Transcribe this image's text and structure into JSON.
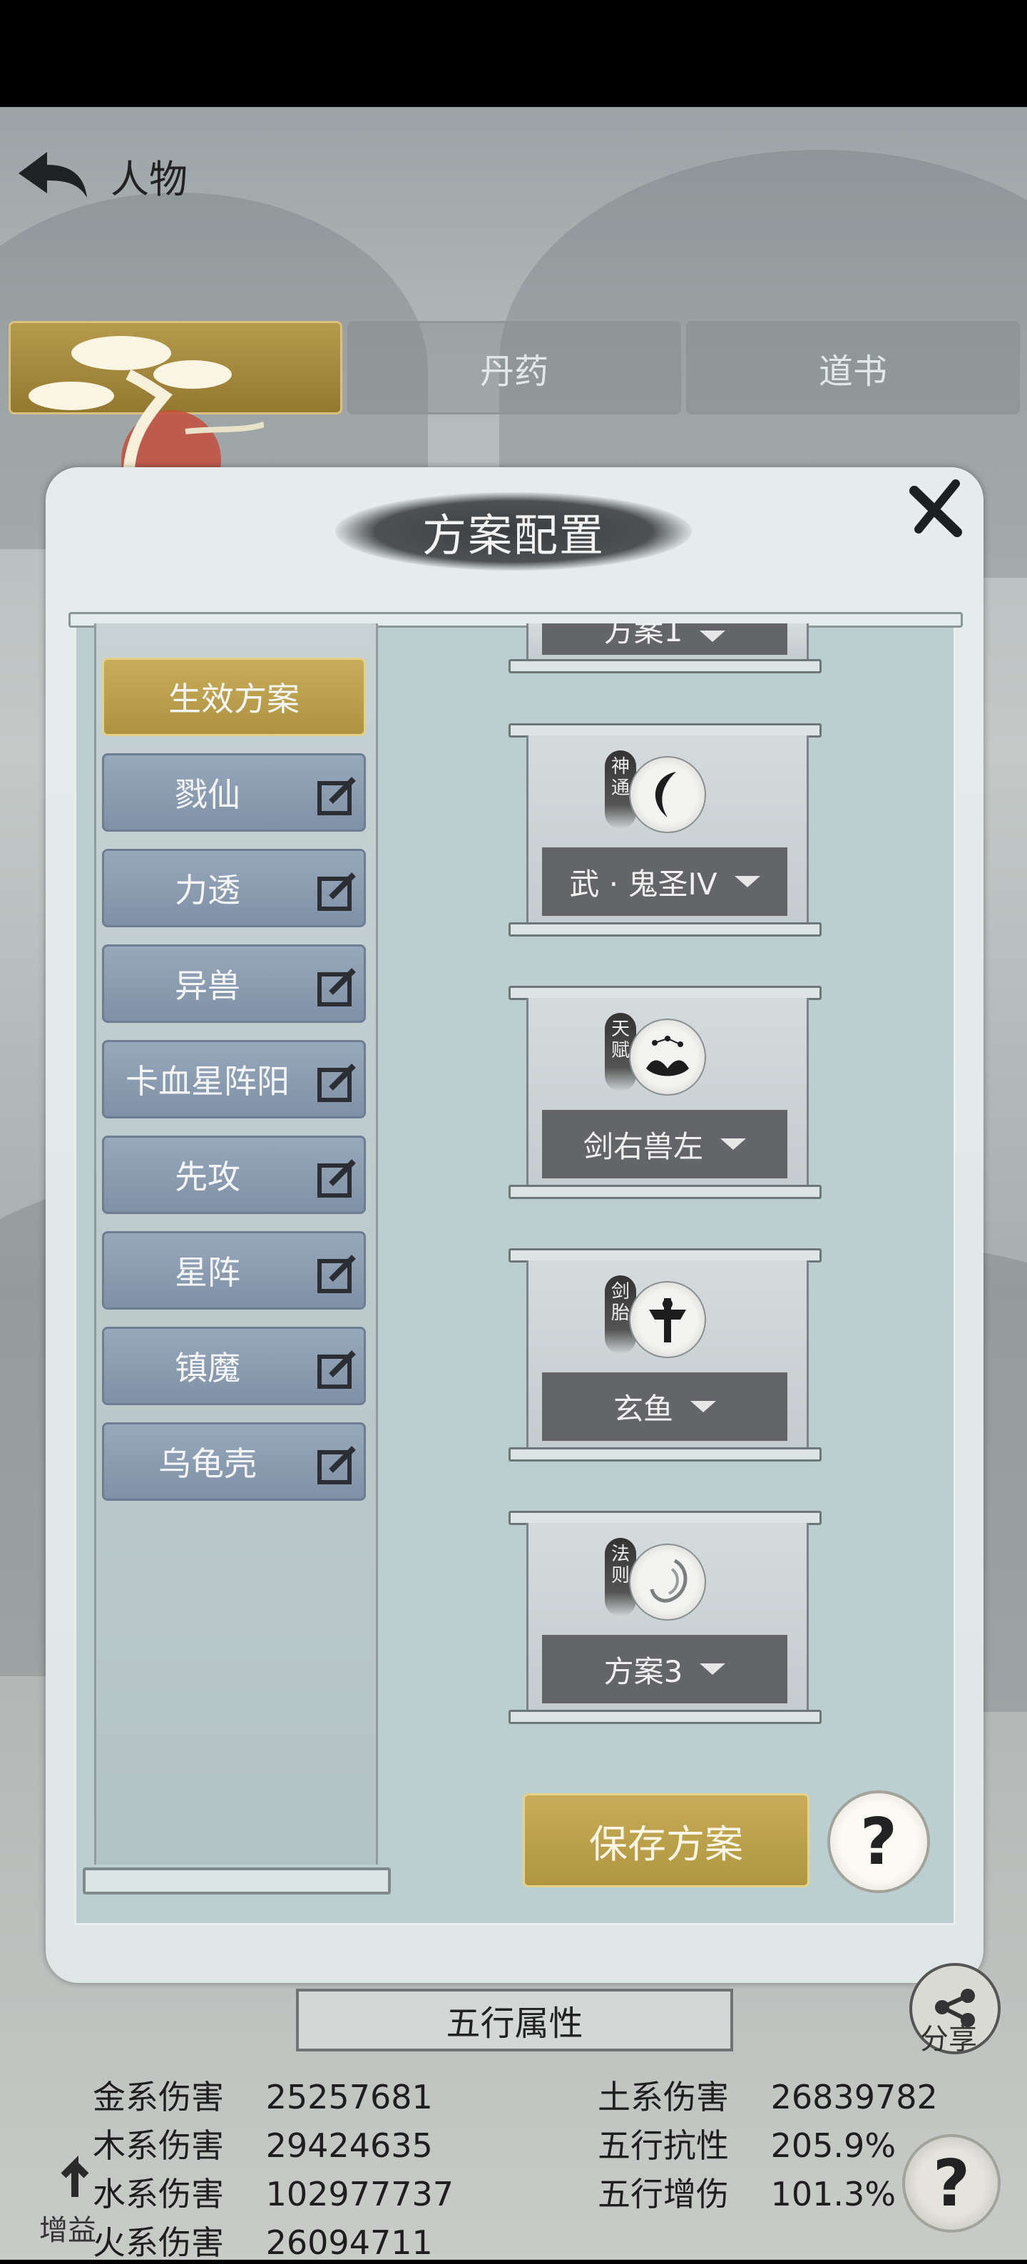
{
  "topbar": {
    "title": "人物"
  },
  "tabs": [
    {
      "label": "",
      "active": true
    },
    {
      "label": "丹药",
      "active": false
    },
    {
      "label": "道书",
      "active": false
    }
  ],
  "modal": {
    "title": "方案配置",
    "active_plan_label": "生效方案",
    "plans": [
      "戮仙",
      "力透",
      "异兽",
      "卡血星阵阳",
      "先攻",
      "星阵",
      "镇魔",
      "乌龟壳"
    ],
    "slots": [
      {
        "tag": "",
        "value": "方案1",
        "icon": "partial-slot-icon"
      },
      {
        "tag": "神通",
        "value": "武 · 鬼圣IV",
        "icon": "crescent-blade-icon"
      },
      {
        "tag": "天赋",
        "value": "剑右兽左",
        "icon": "lotus-constellation-icon"
      },
      {
        "tag": "剑胎",
        "value": "玄鱼",
        "icon": "sword-emblem-icon"
      },
      {
        "tag": "法则",
        "value": "方案3",
        "icon": "swirl-icon"
      }
    ],
    "save_label": "保存方案",
    "help_label": "?"
  },
  "attributes": {
    "header": "五行属性",
    "left": [
      {
        "label": "金系伤害",
        "value": "25257681"
      },
      {
        "label": "木系伤害",
        "value": "29424635"
      },
      {
        "label": "水系伤害",
        "value": "102977737"
      },
      {
        "label": "火系伤害",
        "value": "26094711"
      }
    ],
    "right": [
      {
        "label": "土系伤害",
        "value": "26839782"
      },
      {
        "label": "五行抗性",
        "value": "205.9%"
      },
      {
        "label": "五行增伤",
        "value": "101.3%"
      }
    ]
  },
  "side": {
    "share_label": "分享",
    "boost_label": "增益",
    "help_label": "?"
  },
  "colors": {
    "gold": "#b69a4d",
    "plan_blue": "#8a9bb0",
    "dropdown": "#636568"
  }
}
